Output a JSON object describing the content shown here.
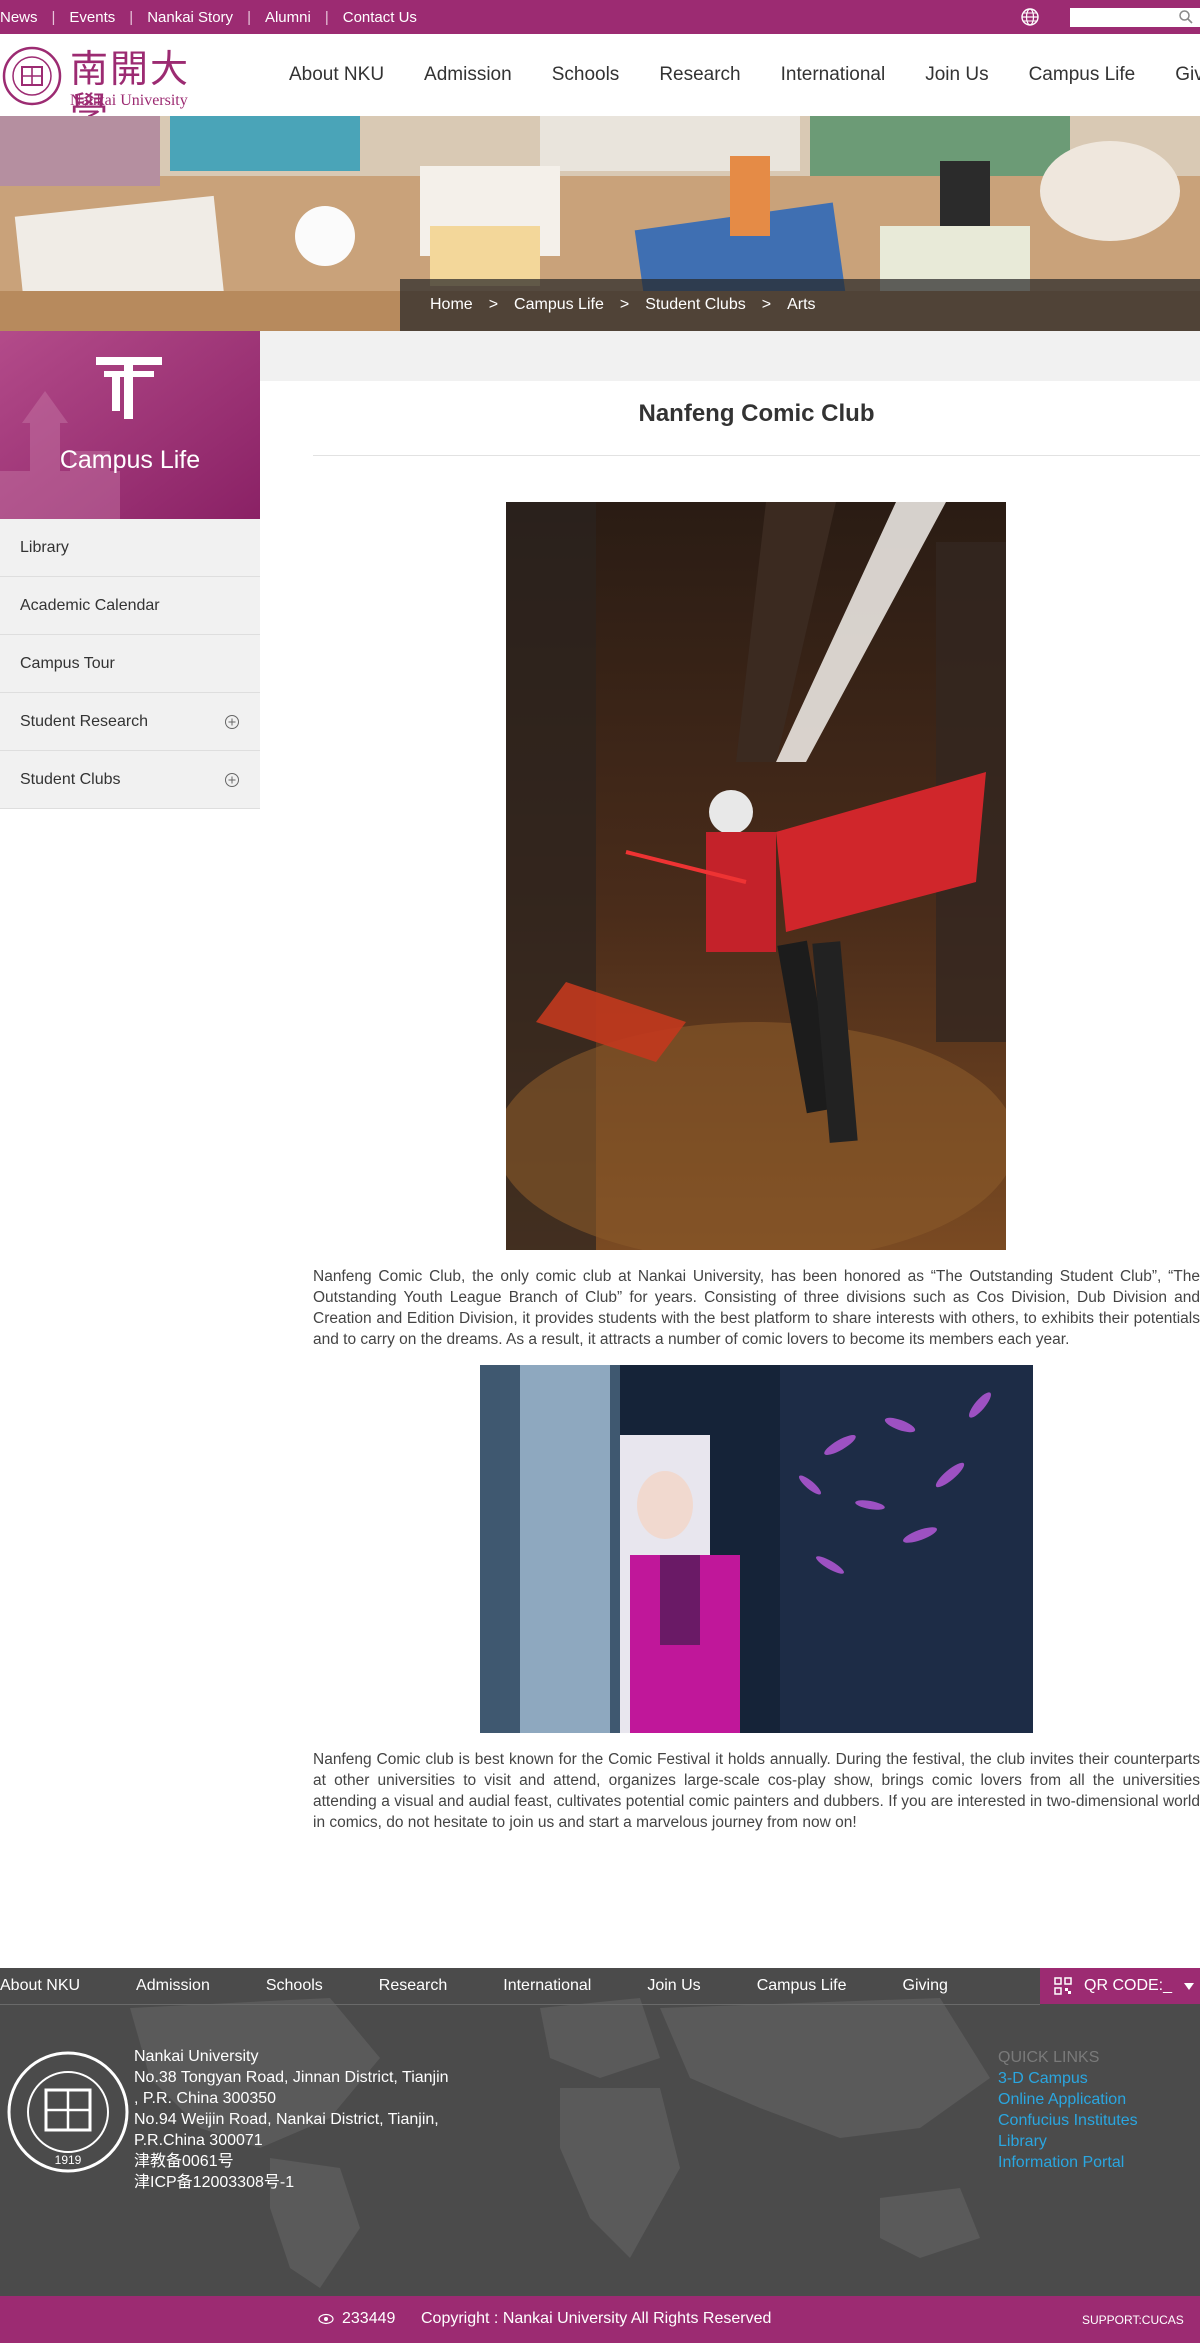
{
  "topbar": {
    "links": [
      "News",
      "Events",
      "Nankai Story",
      "Alumni",
      "Contact Us"
    ],
    "search_placeholder": ""
  },
  "header": {
    "logo_cn": "南開大學",
    "logo_en": "Nankai University",
    "nav": [
      "About NKU",
      "Admission",
      "Schools",
      "Research",
      "International",
      "Join Us",
      "Campus Life",
      "Giving"
    ]
  },
  "breadcrumb": [
    "Home",
    "Campus Life",
    "Student Clubs",
    "Arts"
  ],
  "breadcrumb_separator": ">",
  "sidebar": {
    "title": "Campus Life",
    "items": [
      {
        "label": "Library"
      },
      {
        "label": "Academic Calendar"
      },
      {
        "label": "Campus Tour"
      },
      {
        "label": "Student Research"
      },
      {
        "label": "Student Clubs"
      }
    ]
  },
  "article": {
    "title": "Nanfeng Comic Club",
    "paragraph1": "Nanfeng Comic Club, the only comic club at Nankai University, has been honored as “The Outstanding Student Club”, “The Outstanding Youth League Branch of Club” for years. Consisting of three divisions such as Cos Division, Dub Division and Creation and Edition Division, it provides students with the best platform to share interests with others, to exhibits their potentials and to carry on the dreams. As a result, it attracts a number of comic lovers to become its members each year.",
    "paragraph2": "Nanfeng Comic club is best known for the Comic Festival it holds annually. During the festival, the club invites their counterparts at other universities to visit and attend, organizes large-scale cos-play show, brings comic lovers from all the universities attending a visual and audial feast, cultivates potential comic painters and dubbers. If you are interested in two-dimensional world in comics, do not hesitate to join us and start a marvelous journey from now on!"
  },
  "footer": {
    "nav": [
      "About NKU",
      "Admission",
      "Schools",
      "Research",
      "International",
      "Join Us",
      "Campus Life",
      "Giving"
    ],
    "qr_label": "QR CODE:_",
    "seal_year": "1919",
    "address_lines": [
      "Nankai University",
      "No.38 Tongyan Road, Jinnan District, Tianjin",
      ", P.R. China 300350",
      "No.94 Weijin Road,  Nankai District, Tianjin,",
      "P.R.China  300071",
      "津教备0061号",
      "津ICP备12003308号-1"
    ],
    "quick_links_title": "QUICK LINKS",
    "quick_links": [
      "3-D Campus",
      "Online Application",
      "Confucius Institutes",
      "Library",
      "Information Portal"
    ],
    "visits": "233449",
    "copyright": "Copyright : Nankai University All Rights Reserved",
    "support": "SUPPORT:CUCAS"
  },
  "colors": {
    "brand": "#9c2b72",
    "footer_bg": "#4b4b4b",
    "link_blue": "#2aa6e0"
  }
}
